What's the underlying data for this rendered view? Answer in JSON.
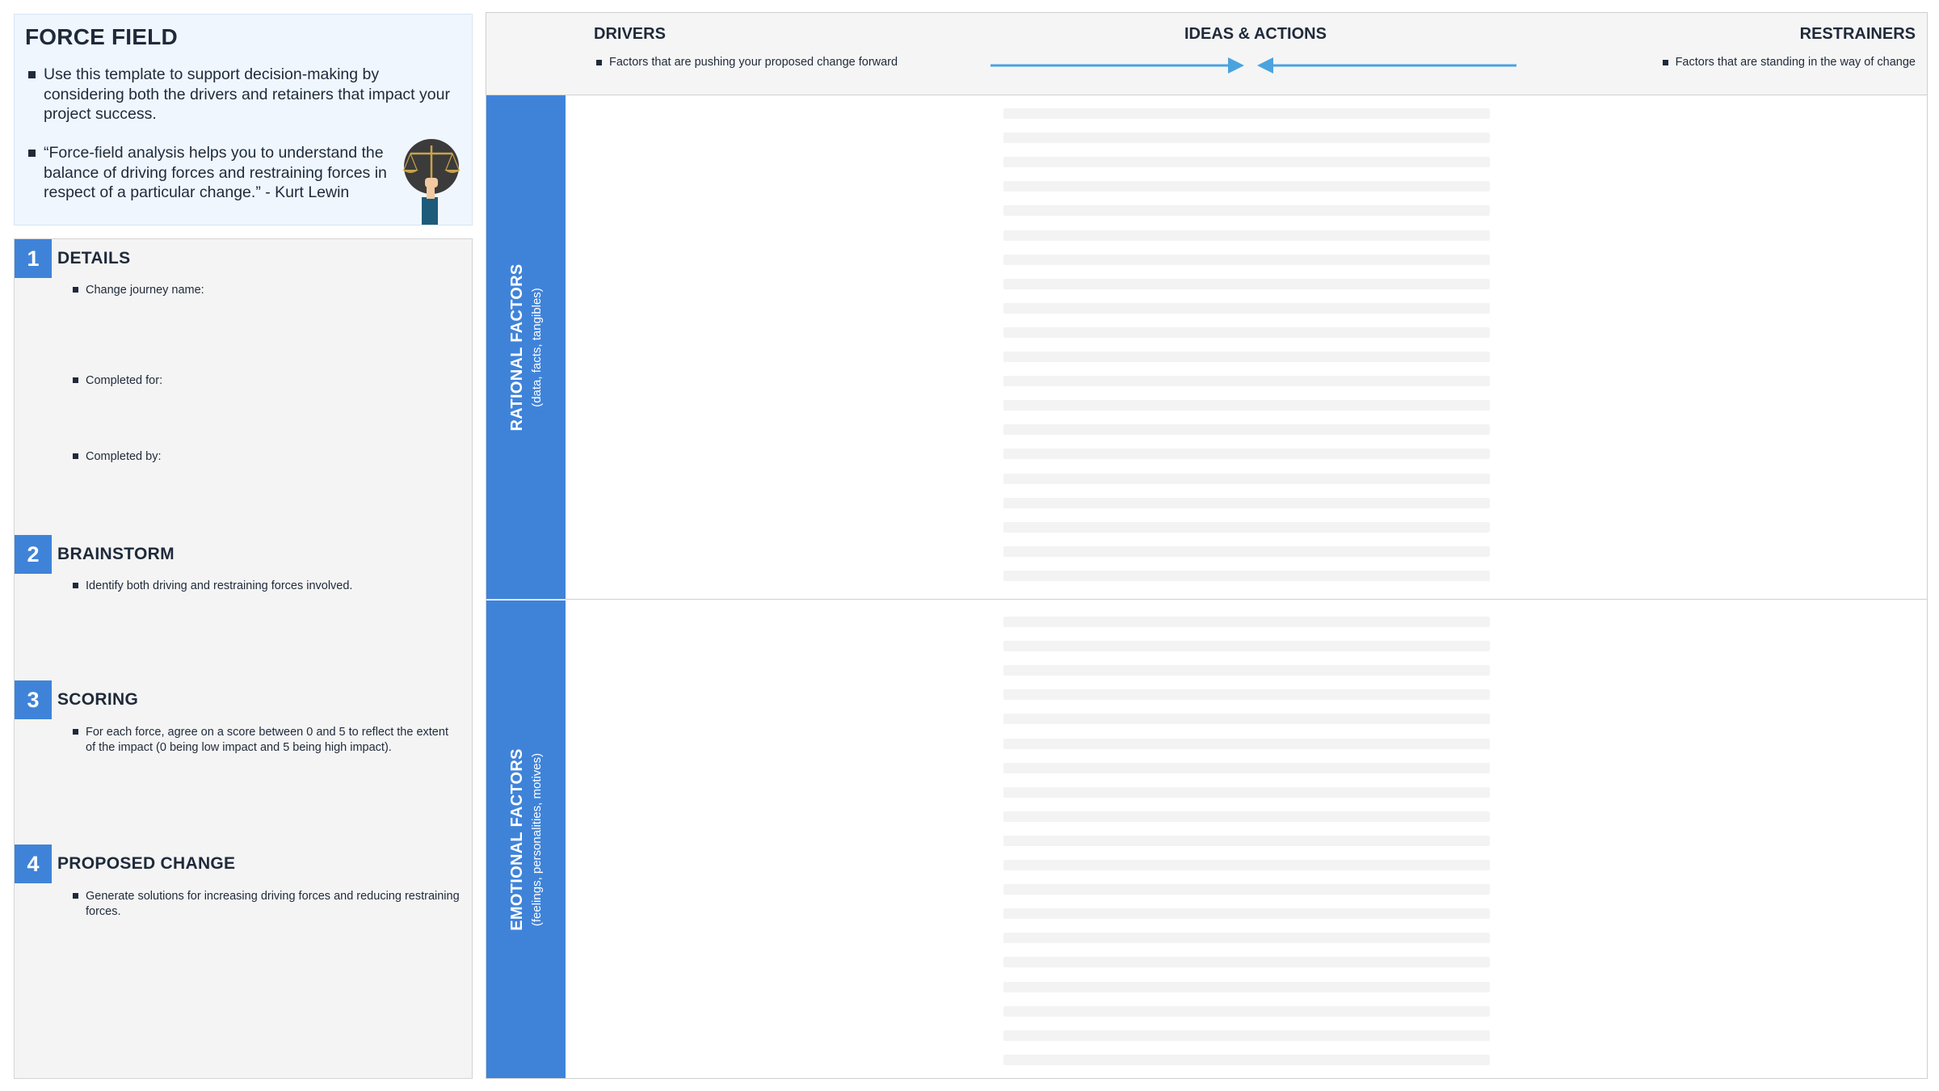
{
  "intro": {
    "title": "FORCE FIELD",
    "bullets": [
      "Use this template to support decision-making by considering both the drivers and retainers that impact your project success.",
      "“Force-field analysis helps you to understand the balance of driving forces and restraining forces in respect of a particular change.” - Kurt Lewin"
    ],
    "icon": "scales-of-justice-icon"
  },
  "steps": [
    {
      "number": "1",
      "title": "DETAILS",
      "items": [
        "Change journey name:",
        "Completed for:",
        "Completed by:"
      ]
    },
    {
      "number": "2",
      "title": "BRAINSTORM",
      "items": [
        "Identify both driving and restraining forces involved."
      ]
    },
    {
      "number": "3",
      "title": "SCORING",
      "items": [
        "For each force, agree on a score between 0 and 5 to reflect the extent of the impact (0 being low impact and 5 being high impact)."
      ]
    },
    {
      "number": "4",
      "title": "PROPOSED CHANGE",
      "items": [
        "Generate solutions for increasing driving forces and reducing restraining forces."
      ]
    }
  ],
  "board": {
    "drivers": {
      "title": "DRIVERS",
      "description": "Factors that are pushing your proposed change forward"
    },
    "ideas": {
      "title": "IDEAS & ACTIONS"
    },
    "restrainers": {
      "title": "RESTRAINERS",
      "description": "Factors that are standing in the way of change"
    },
    "rows": [
      {
        "label": "RATIONAL FACTORS",
        "sublabel": "(data, facts, tangibles)",
        "placeholder_lines": 20
      },
      {
        "label": "EMOTIONAL FACTORS",
        "sublabel": "(feelings, personalities, motives)",
        "placeholder_lines": 19
      }
    ]
  },
  "colors": {
    "accent": "#3f83d9",
    "arrow": "#4aa3df",
    "intro_bg": "#f0f6fd",
    "panel_bg": "#f4f4f4",
    "text": "#1f2a3a"
  }
}
